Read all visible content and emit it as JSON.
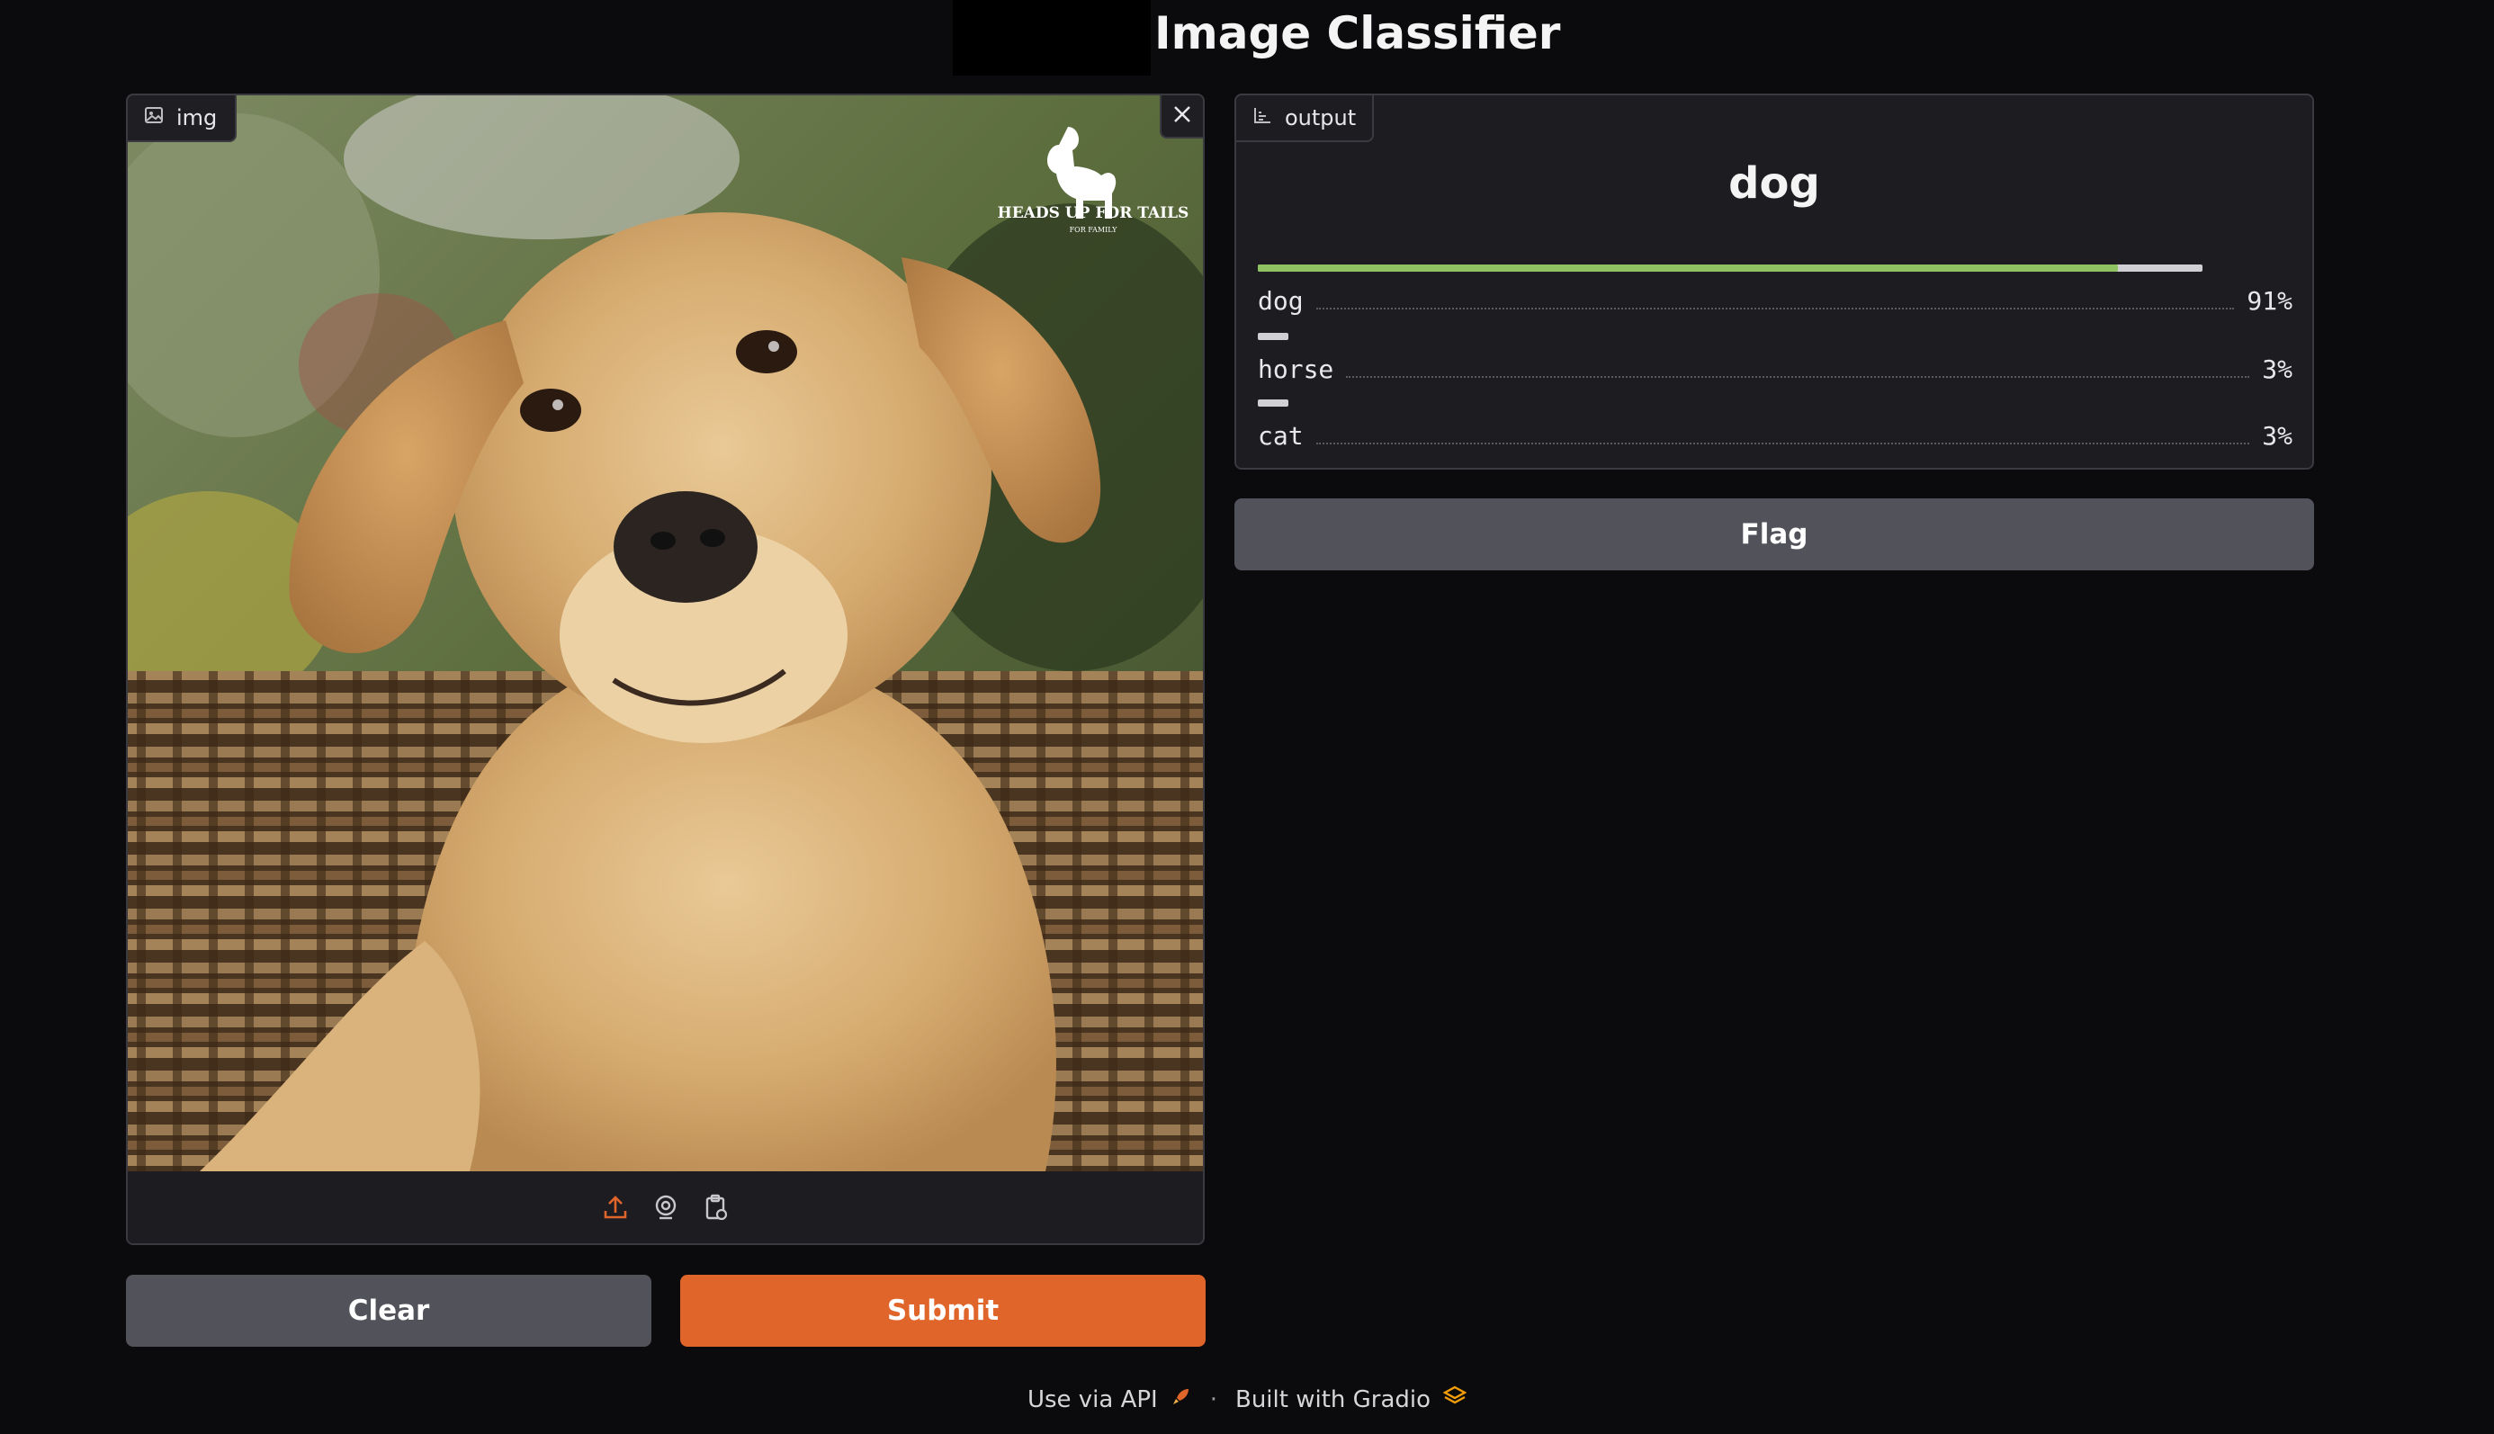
{
  "app": {
    "title": "Image Classifier"
  },
  "input_panel": {
    "label": "img",
    "image_alt": "Golden retriever puppy on wicker chair",
    "watermark_line1": "HEADS UP FOR TAILS",
    "watermark_line2": "FOR FAMILY",
    "toolbar": [
      "upload-icon",
      "webcam-icon",
      "clipboard-icon"
    ]
  },
  "output_panel": {
    "label": "output",
    "top_label": "dog",
    "confidences": [
      {
        "label": "dog",
        "percent_text": "91%",
        "fraction": 0.91
      },
      {
        "label": "horse",
        "percent_text": "3%",
        "fraction": 0.03
      },
      {
        "label": "cat",
        "percent_text": "3%",
        "fraction": 0.03
      }
    ]
  },
  "buttons": {
    "clear": "Clear",
    "submit": "Submit",
    "flag": "Flag"
  },
  "footer": {
    "api": "Use via API",
    "separator": "·",
    "built_with": "Built with Gradio"
  },
  "colors": {
    "accent": "#e0652a",
    "confidence_fill": "#8fc262",
    "background": "#0b0b0d",
    "panel": "#1d1d21"
  }
}
